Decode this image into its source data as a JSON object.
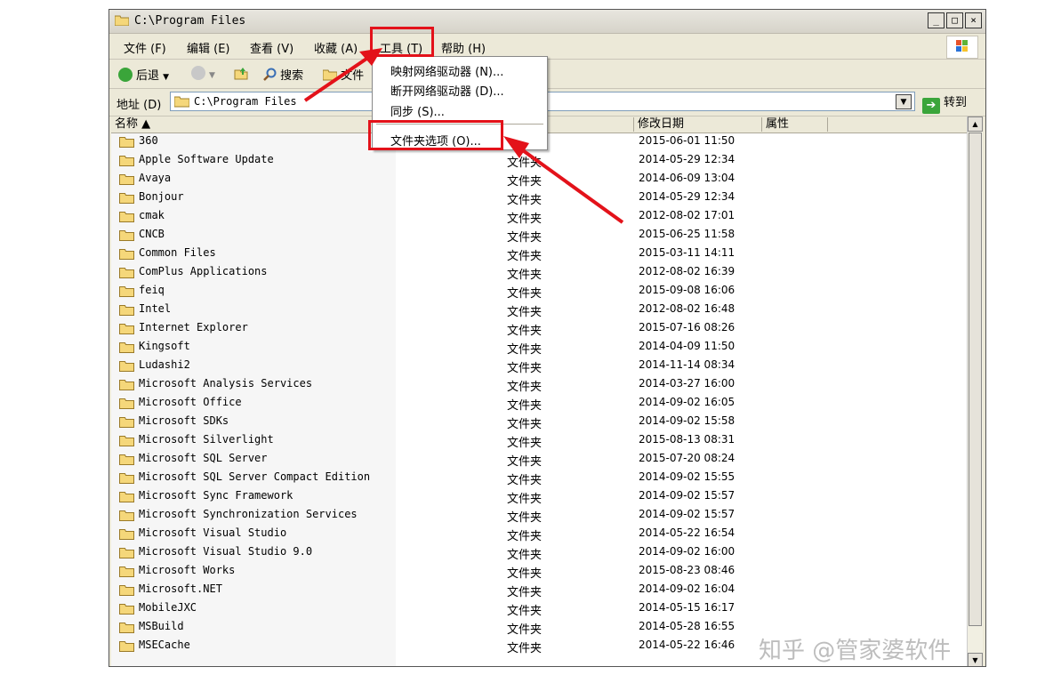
{
  "window": {
    "title": "C:\\Program Files",
    "minimize": "_",
    "maximize": "□",
    "close": "×"
  },
  "menu": {
    "file": "文件 (F)",
    "edit": "编辑 (E)",
    "view": "查看 (V)",
    "favorites": "收藏 (A)",
    "tools": "工具 (T)",
    "help": "帮助 (H)"
  },
  "toolbar": {
    "back": "后退",
    "search": "搜索",
    "folders": "文件"
  },
  "address": {
    "label": "地址 (D)",
    "value": "C:\\Program Files",
    "go": "转到"
  },
  "columns": {
    "name": "名称 ▲",
    "modified": "修改日期",
    "attributes": "属性"
  },
  "tools_menu": {
    "map_drive": "映射网络驱动器 (N)...",
    "disconnect_drive": "断开网络驱动器 (D)...",
    "sync": "同步 (S)...",
    "folder_options": "文件夹选项 (O)..."
  },
  "files": [
    {
      "name": "360",
      "type": "",
      "date": "2015-06-01 11:50"
    },
    {
      "name": "Apple Software Update",
      "type": "文件夹",
      "date": "2014-05-29 12:34"
    },
    {
      "name": "Avaya",
      "type": "文件夹",
      "date": "2014-06-09 13:04"
    },
    {
      "name": "Bonjour",
      "type": "文件夹",
      "date": "2014-05-29 12:34"
    },
    {
      "name": "cmak",
      "type": "文件夹",
      "date": "2012-08-02 17:01"
    },
    {
      "name": "CNCB",
      "type": "文件夹",
      "date": "2015-06-25 11:58"
    },
    {
      "name": "Common Files",
      "type": "文件夹",
      "date": "2015-03-11 14:11"
    },
    {
      "name": "ComPlus Applications",
      "type": "文件夹",
      "date": "2012-08-02 16:39"
    },
    {
      "name": "feiq",
      "type": "文件夹",
      "date": "2015-09-08 16:06"
    },
    {
      "name": "Intel",
      "type": "文件夹",
      "date": "2012-08-02 16:48"
    },
    {
      "name": "Internet Explorer",
      "type": "文件夹",
      "date": "2015-07-16 08:26"
    },
    {
      "name": "Kingsoft",
      "type": "文件夹",
      "date": "2014-04-09 11:50"
    },
    {
      "name": "Ludashi2",
      "type": "文件夹",
      "date": "2014-11-14 08:34"
    },
    {
      "name": "Microsoft Analysis Services",
      "type": "文件夹",
      "date": "2014-03-27 16:00"
    },
    {
      "name": "Microsoft Office",
      "type": "文件夹",
      "date": "2014-09-02 16:05"
    },
    {
      "name": "Microsoft SDKs",
      "type": "文件夹",
      "date": "2014-09-02 15:58"
    },
    {
      "name": "Microsoft Silverlight",
      "type": "文件夹",
      "date": "2015-08-13 08:31"
    },
    {
      "name": "Microsoft SQL Server",
      "type": "文件夹",
      "date": "2015-07-20 08:24"
    },
    {
      "name": "Microsoft SQL Server Compact Edition",
      "type": "文件夹",
      "date": "2014-09-02 15:55"
    },
    {
      "name": "Microsoft Sync Framework",
      "type": "文件夹",
      "date": "2014-09-02 15:57"
    },
    {
      "name": "Microsoft Synchronization Services",
      "type": "文件夹",
      "date": "2014-09-02 15:57"
    },
    {
      "name": "Microsoft Visual Studio",
      "type": "文件夹",
      "date": "2014-05-22 16:54"
    },
    {
      "name": "Microsoft Visual Studio 9.0",
      "type": "文件夹",
      "date": "2014-09-02 16:00"
    },
    {
      "name": "Microsoft Works",
      "type": "文件夹",
      "date": "2015-08-23 08:46"
    },
    {
      "name": "Microsoft.NET",
      "type": "文件夹",
      "date": "2014-09-02 16:04"
    },
    {
      "name": "MobileJXC",
      "type": "文件夹",
      "date": "2014-05-15 16:17"
    },
    {
      "name": "MSBuild",
      "type": "文件夹",
      "date": "2014-05-28 16:55"
    },
    {
      "name": "MSECache",
      "type": "文件夹",
      "date": "2014-05-22 16:46"
    }
  ],
  "watermark": "知乎 @管家婆软件",
  "colors": {
    "highlight": "#e3121a",
    "folder": "#f5d77a"
  }
}
